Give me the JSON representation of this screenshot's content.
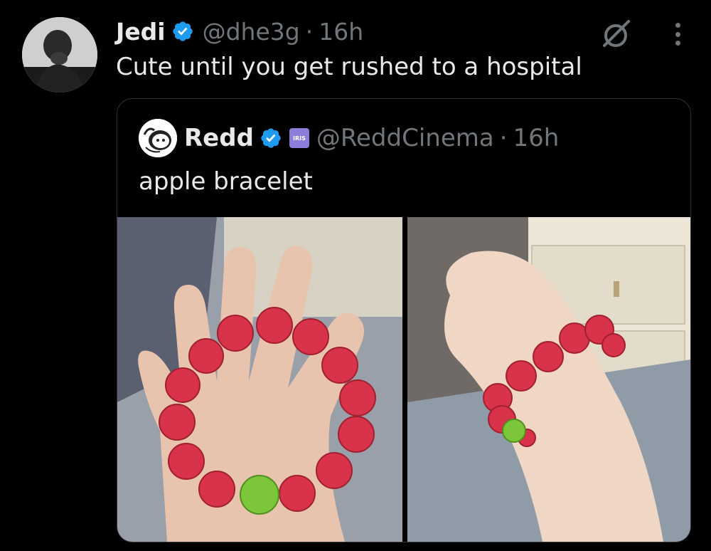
{
  "tweet": {
    "author_name": "Jedi",
    "handle": "@dhe3g",
    "separator": "·",
    "time": "16h",
    "text": "Cute until you get rushed to a hospital"
  },
  "quoted_tweet": {
    "author_name": "Redd",
    "handle": "@ReddCinema",
    "separator": "·",
    "time": "16h",
    "badge_text": "IRIS",
    "text": "apple bracelet"
  },
  "icons": {
    "verified": "verified-badge-icon",
    "grok": "grok-icon",
    "more": "more-options-icon"
  },
  "colors": {
    "background": "#000000",
    "text": "#e7e9ea",
    "muted": "#71767b",
    "verified_blue": "#1d9bf0",
    "border": "#2f3336"
  }
}
